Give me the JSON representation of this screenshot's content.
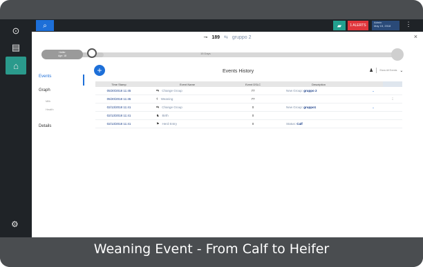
{
  "window": {
    "brand_icon": "logo-icon",
    "search_icon": "search-icon",
    "herd_icon": "cow-icon",
    "alerts_label": "1 ALERTS",
    "user_line1": "Admin",
    "user_line2": "May 15, 2018",
    "more_icon": "kebab-icon"
  },
  "rail": {
    "items": [
      {
        "icon": "dashboard-icon",
        "glyph": "⊙"
      },
      {
        "icon": "document-icon",
        "glyph": "▤"
      },
      {
        "icon": "herd-icon",
        "glyph": "⌂"
      }
    ],
    "settings_glyph": "⚙"
  },
  "animal": {
    "tag": "189",
    "group_name": "gruppo 2",
    "close_glyph": "×"
  },
  "timeline": {
    "start_line1": "Heifer",
    "start_line2": "Age: 18",
    "center_label": "15 Days",
    "progress": 0.14
  },
  "tabs": {
    "events": "Events",
    "graph": "Graph",
    "sub1": "Milk",
    "sub2": "Health",
    "details": "Details"
  },
  "events": {
    "title": "Events History",
    "add_glyph": "+",
    "filter_value": "Show All Events",
    "columns": [
      "Time Stamp",
      "Event Name",
      "Event DSLC",
      "Description",
      "",
      ""
    ],
    "rows": [
      {
        "time": "05/20/2018 11:45",
        "icon": "⇆",
        "event": "Change Group",
        "dslc": "77",
        "desc_label": "New Group:",
        "desc_value": "gruppo 2",
        "chev": "⌄",
        "menu": ""
      },
      {
        "time": "05/20/2018 11:45",
        "icon": "⚕",
        "event": "Weaning",
        "dslc": "77",
        "desc_label": "",
        "desc_value": "",
        "chev": "",
        "menu": "⋮"
      },
      {
        "time": "02/13/2018 11:41",
        "icon": "⇆",
        "event": "Change Group",
        "dslc": "0",
        "desc_label": "New Group:",
        "desc_value": "gruppo1",
        "chev": "⌄",
        "menu": ""
      },
      {
        "time": "02/13/2018 11:41",
        "icon": "♞",
        "event": "Birth",
        "dslc": "0",
        "desc_label": "",
        "desc_value": "",
        "chev": "",
        "menu": ""
      },
      {
        "time": "02/13/2018 11:41",
        "icon": "⚑",
        "event": "Herd Entry",
        "dslc": "0",
        "desc_label": "Status:",
        "desc_value": "Calf",
        "chev": "",
        "menu": ""
      }
    ]
  },
  "caption": "Weaning Event - From Calf to Heifer",
  "colors": {
    "accent": "#1d6fd8",
    "alert": "#e0363c",
    "teal": "#2a9a8c",
    "frame": "#4a4d50"
  }
}
